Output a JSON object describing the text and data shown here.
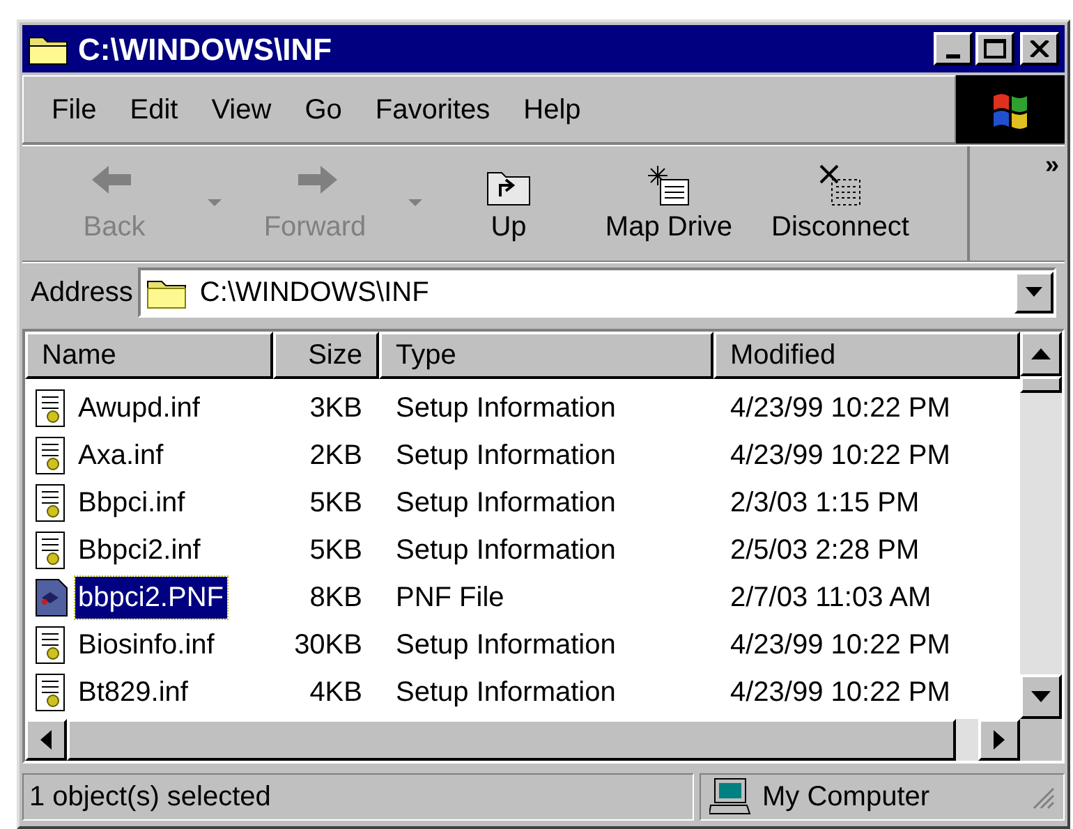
{
  "window": {
    "title": "C:\\WINDOWS\\INF"
  },
  "menu": [
    {
      "label": "File"
    },
    {
      "label": "Edit"
    },
    {
      "label": "View"
    },
    {
      "label": "Go"
    },
    {
      "label": "Favorites"
    },
    {
      "label": "Help"
    }
  ],
  "toolbar": {
    "buttons": [
      {
        "kind": "back",
        "label": "Back",
        "disabled": true,
        "dropdown": true
      },
      {
        "kind": "forward",
        "label": "Forward",
        "disabled": true,
        "dropdown": true
      },
      {
        "kind": "up",
        "label": "Up",
        "disabled": false,
        "dropdown": false
      },
      {
        "kind": "map",
        "label": "Map Drive",
        "disabled": false,
        "dropdown": false
      },
      {
        "kind": "disconnect",
        "label": "Disconnect",
        "disabled": false,
        "dropdown": false
      }
    ],
    "more": "»"
  },
  "address": {
    "label": "Address",
    "value": "C:\\WINDOWS\\INF"
  },
  "table": {
    "columns": [
      "Name",
      "Size",
      "Type",
      "Modified"
    ],
    "rows": [
      {
        "kind": "inf",
        "name": "Awupd.inf",
        "size": "3KB",
        "type": "Setup Information",
        "modified": "4/23/99 10:22 PM",
        "selected": false
      },
      {
        "kind": "inf",
        "name": "Axa.inf",
        "size": "2KB",
        "type": "Setup Information",
        "modified": "4/23/99 10:22 PM",
        "selected": false
      },
      {
        "kind": "inf",
        "name": "Bbpci.inf",
        "size": "5KB",
        "type": "Setup Information",
        "modified": "2/3/03 1:15 PM",
        "selected": false
      },
      {
        "kind": "inf",
        "name": "Bbpci2.inf",
        "size": "5KB",
        "type": "Setup Information",
        "modified": "2/5/03 2:28 PM",
        "selected": false
      },
      {
        "kind": "pnf",
        "name": "bbpci2.PNF",
        "size": "8KB",
        "type": "PNF File",
        "modified": "2/7/03 11:03 AM",
        "selected": true
      },
      {
        "kind": "inf",
        "name": "Biosinfo.inf",
        "size": "30KB",
        "type": "Setup Information",
        "modified": "4/23/99 10:22 PM",
        "selected": false
      },
      {
        "kind": "inf",
        "name": "Bt829.inf",
        "size": "4KB",
        "type": "Setup Information",
        "modified": "4/23/99 10:22 PM",
        "selected": false
      }
    ]
  },
  "status_bar": {
    "text": "1 object(s) selected",
    "zone": "My Computer"
  }
}
